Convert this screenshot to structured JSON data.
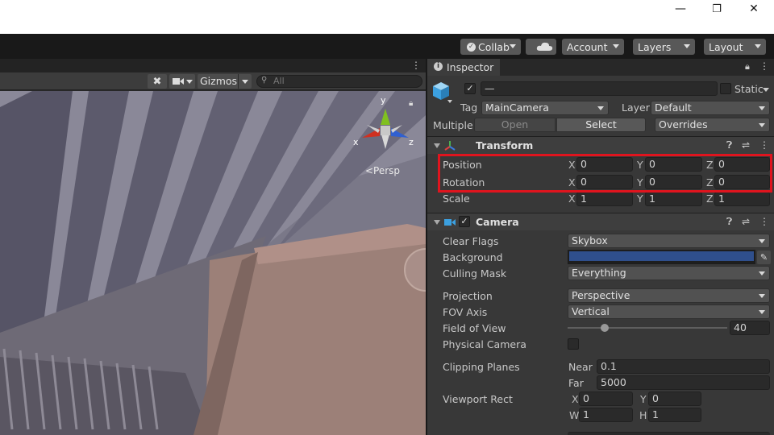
{
  "window": {
    "minimize_glyph": "—",
    "maximize_glyph": "❐",
    "close_glyph": "✕"
  },
  "toolbar": {
    "collab_label": "Collab",
    "account_label": "Account",
    "layers_label": "Layers",
    "layout_label": "Layout"
  },
  "scene": {
    "gizmos_label": "Gizmos",
    "search_placeholder": "All",
    "persp_label": "<Persp",
    "axis_x": "x",
    "axis_y": "y",
    "axis_z": "z"
  },
  "inspector": {
    "tab_label": "Inspector",
    "object_name": "—",
    "static_label": "Static",
    "tag_label": "Tag",
    "tag_value": "MainCamera",
    "layer_label": "Layer",
    "layer_value": "Default",
    "multiple_label": "Multiple",
    "open_label": "Open",
    "select_label": "Select",
    "overrides_label": "Overrides",
    "transform": {
      "title": "Transform",
      "position_label": "Position",
      "rotation_label": "Rotation",
      "scale_label": "Scale",
      "axis_x": "X",
      "axis_y": "Y",
      "axis_z": "Z",
      "position": {
        "x": "0",
        "y": "0",
        "z": "0"
      },
      "rotation": {
        "x": "0",
        "y": "0",
        "z": "0"
      },
      "scale": {
        "x": "1",
        "y": "1",
        "z": "1"
      }
    },
    "camera": {
      "title": "Camera",
      "clear_flags_label": "Clear Flags",
      "clear_flags_value": "Skybox",
      "background_label": "Background",
      "background_color": "#2f4f8c",
      "culling_mask_label": "Culling Mask",
      "culling_mask_value": "Everything",
      "projection_label": "Projection",
      "projection_value": "Perspective",
      "fov_axis_label": "FOV Axis",
      "fov_axis_value": "Vertical",
      "field_of_view_label": "Field of View",
      "field_of_view_value": "40",
      "physical_camera_label": "Physical Camera",
      "clipping_planes_label": "Clipping Planes",
      "near_label": "Near",
      "near_value": "0.1",
      "far_label": "Far",
      "far_value": "5000",
      "viewport_rect_label": "Viewport Rect",
      "vp_x_label": "X",
      "vp_x_value": "0",
      "vp_y_label": "Y",
      "vp_y_value": "0",
      "vp_w_label": "W",
      "vp_w_value": "1",
      "vp_h_label": "H",
      "vp_h_value": "1"
    }
  },
  "colors": {
    "highlight": "#e0141e",
    "transform_icon": "#4caf50",
    "camera_icon": "#3ca0e0",
    "gizmo_x": "#d03020",
    "gizmo_y": "#80c020",
    "gizmo_z": "#3060d0"
  }
}
